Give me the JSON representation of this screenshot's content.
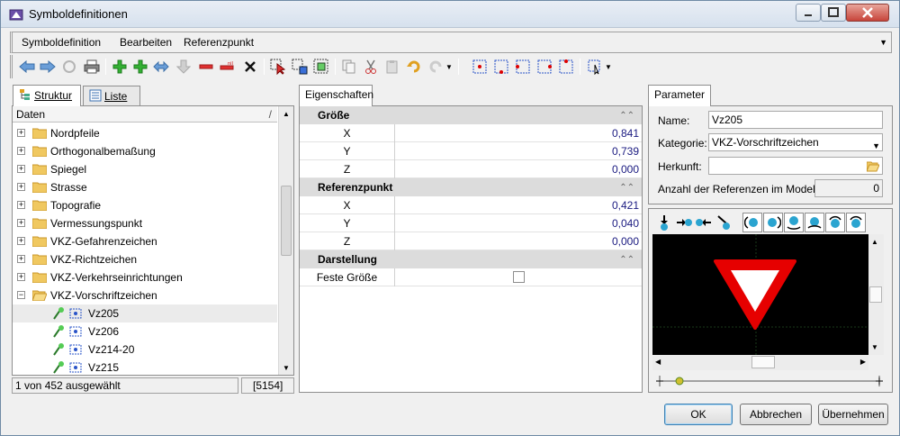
{
  "window": {
    "title": "Symboldefinitionen"
  },
  "menu": {
    "items": [
      "Symboldefinition",
      "Bearbeiten",
      "Referenzpunkt"
    ]
  },
  "left": {
    "tabs": [
      "Struktur",
      "Liste"
    ],
    "tree_header": "Daten",
    "tree_header_mark": "/",
    "folders": [
      "Nordpfeile",
      "Orthogonalbemaßung",
      "Spiegel",
      "Strasse",
      "Topografie",
      "Vermessungspunkt",
      "VKZ-Gefahrenzeichen",
      "VKZ-Richtzeichen",
      "VKZ-Verkehrseinrichtungen",
      "VKZ-Vorschriftzeichen"
    ],
    "children": [
      "Vz205",
      "Vz206",
      "Vz214-20",
      "Vz215"
    ],
    "status": {
      "selected_text": "1 von 452 ausgewählt",
      "count": "[5154]"
    }
  },
  "middle": {
    "tab": "Eigenschaften",
    "groups": [
      {
        "title": "Größe",
        "rows": [
          {
            "name": "X",
            "value": "0,841"
          },
          {
            "name": "Y",
            "value": "0,739"
          },
          {
            "name": "Z",
            "value": "0,000"
          }
        ]
      },
      {
        "title": "Referenzpunkt",
        "rows": [
          {
            "name": "X",
            "value": "0,421"
          },
          {
            "name": "Y",
            "value": "0,040"
          },
          {
            "name": "Z",
            "value": "0,000"
          }
        ]
      },
      {
        "title": "Darstellung",
        "rows": [
          {
            "name": "Feste Größe",
            "value": ""
          }
        ]
      }
    ]
  },
  "right": {
    "tab": "Parameter",
    "name_label": "Name:",
    "name_value": "Vz205",
    "category_label": "Kategorie:",
    "category_value": "VKZ-Vorschriftzeichen",
    "origin_label": "Herkunft:",
    "origin_value": "",
    "refcount_label": "Anzahl der Referenzen im Modell:",
    "refcount_value": "0"
  },
  "buttons": {
    "ok": "OK",
    "cancel": "Abbrechen",
    "apply": "Übernehmen"
  },
  "colors": {
    "accent": "#3c7fb1",
    "sign_red": "#e60000"
  }
}
